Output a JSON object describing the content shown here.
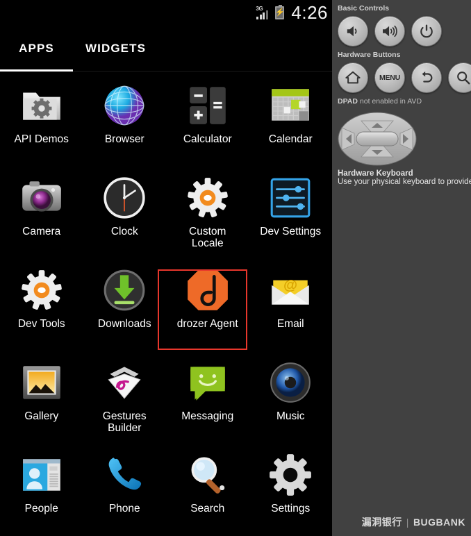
{
  "statusbar": {
    "network_label": "3G",
    "time": "4:26",
    "battery_state": "charging"
  },
  "tabs": [
    {
      "id": "apps",
      "label": "APPS",
      "selected": true
    },
    {
      "id": "widgets",
      "label": "WIDGETS",
      "selected": false
    }
  ],
  "apps": [
    {
      "name": "API Demos",
      "icon": "folder-gear-icon",
      "highlighted": false
    },
    {
      "name": "Browser",
      "icon": "globe-icon",
      "highlighted": false
    },
    {
      "name": "Calculator",
      "icon": "calculator-icon",
      "highlighted": false
    },
    {
      "name": "Calendar",
      "icon": "calendar-icon",
      "highlighted": false
    },
    {
      "name": "Camera",
      "icon": "camera-icon",
      "highlighted": false
    },
    {
      "name": "Clock",
      "icon": "clock-icon",
      "highlighted": false
    },
    {
      "name": "Custom\nLocale",
      "icon": "gear-orange-icon",
      "highlighted": false
    },
    {
      "name": "Dev Settings",
      "icon": "sliders-icon",
      "highlighted": false
    },
    {
      "name": "Dev Tools",
      "icon": "gear-orange-icon",
      "highlighted": false
    },
    {
      "name": "Downloads",
      "icon": "download-arrow-icon",
      "highlighted": false
    },
    {
      "name": "drozer Agent",
      "icon": "drozer-icon",
      "highlighted": true
    },
    {
      "name": "Email",
      "icon": "envelope-at-icon",
      "highlighted": false
    },
    {
      "name": "Gallery",
      "icon": "photo-frame-icon",
      "highlighted": false
    },
    {
      "name": "Gestures\nBuilder",
      "icon": "gestures-icon",
      "highlighted": false
    },
    {
      "name": "Messaging",
      "icon": "speech-bubble-icon",
      "highlighted": false
    },
    {
      "name": "Music",
      "icon": "speaker-icon",
      "highlighted": false
    },
    {
      "name": "People",
      "icon": "contact-card-icon",
      "highlighted": false
    },
    {
      "name": "Phone",
      "icon": "handset-icon",
      "highlighted": false
    },
    {
      "name": "Search",
      "icon": "magnifier-icon",
      "highlighted": false
    },
    {
      "name": "Settings",
      "icon": "gear-gray-icon",
      "highlighted": false
    }
  ],
  "panel": {
    "basic_controls_label": "Basic Controls",
    "basic_controls": [
      {
        "name": "volume-down-button",
        "icon": "speaker-low-icon"
      },
      {
        "name": "volume-up-button",
        "icon": "speaker-high-icon"
      },
      {
        "name": "power-button",
        "icon": "power-icon"
      }
    ],
    "hardware_buttons_label": "Hardware Buttons",
    "hardware_buttons": [
      {
        "name": "home-button",
        "icon": "home-icon",
        "label": ""
      },
      {
        "name": "menu-button",
        "icon": "menu-text",
        "label": "MENU"
      },
      {
        "name": "back-button",
        "icon": "back-arrow-icon",
        "label": ""
      },
      {
        "name": "search-button",
        "icon": "magnifier-icon",
        "label": ""
      }
    ],
    "dpad_label_strong": "DPAD",
    "dpad_label_rest": " not enabled in AVD",
    "hardware_keyboard_title": "Hardware Keyboard",
    "hardware_keyboard_sub": "Use your physical keyboard to provide inpu"
  },
  "watermark": {
    "cn": "漏洞银行",
    "separator": "|",
    "en": "BUGBANK"
  },
  "colors": {
    "highlight": "#e8372c",
    "drozer_orange": "#ee6a28",
    "panel_bg": "#414141",
    "screen_bg": "#000000",
    "accent_text": "#ffffff"
  }
}
